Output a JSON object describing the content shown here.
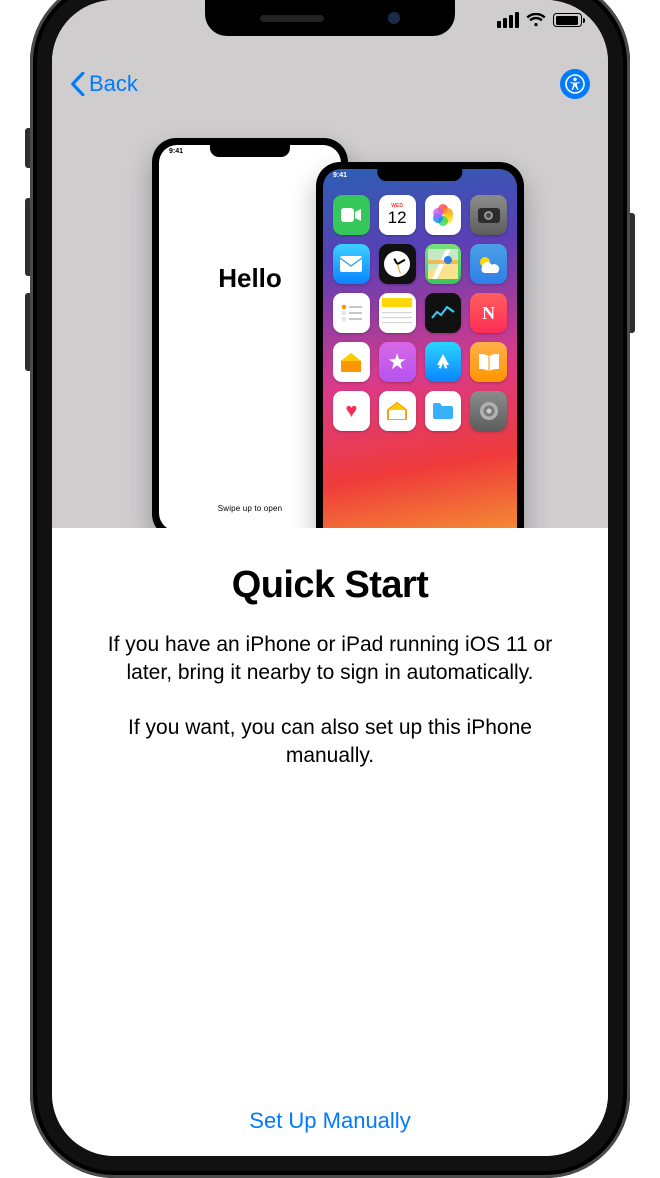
{
  "nav": {
    "back_label": "Back"
  },
  "hero": {
    "phone_left": {
      "greeting": "Hello",
      "swipe_hint": "Swipe up to open",
      "status_time": "9:41"
    },
    "phone_right": {
      "status_time": "9:41",
      "calendar_day": "12",
      "app_icons": [
        "facetime-icon",
        "calendar-icon",
        "photos-icon",
        "camera-icon",
        "mail-icon",
        "clock-icon",
        "maps-icon",
        "weather-icon",
        "reminders-icon",
        "notes-icon",
        "stocks-icon",
        "news-icon",
        "home-icon",
        "favorites-icon",
        "appstore-icon",
        "books-icon",
        "podcasts-icon",
        "tv-icon",
        "health-icon",
        "settings-icon"
      ]
    }
  },
  "content": {
    "title": "Quick Start",
    "paragraph1": "If you have an iPhone or iPad running iOS 11 or later, bring it nearby to sign in automatically.",
    "paragraph2": "If you want, you can also set up this iPhone manually.",
    "manual_link": "Set Up Manually"
  },
  "colors": {
    "link": "#007aff"
  }
}
